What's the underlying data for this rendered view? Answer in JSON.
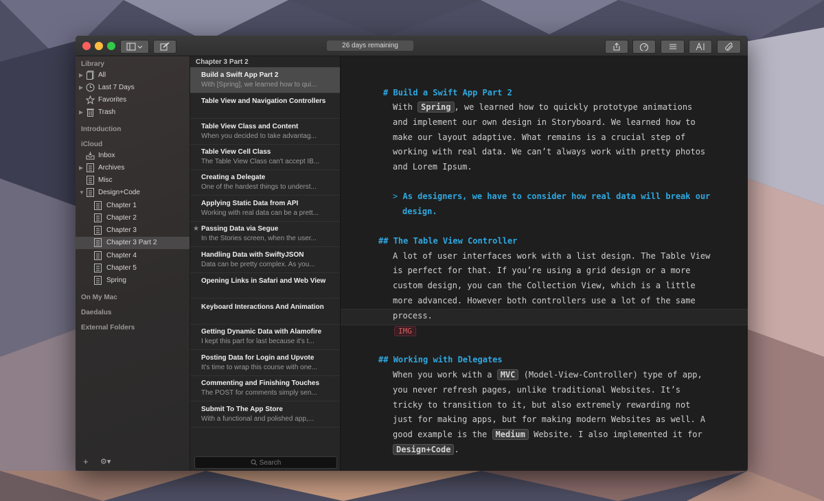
{
  "toolbar": {
    "trial_label": "26 days remaining"
  },
  "sidebar": {
    "library_header": "Library",
    "library_items": [
      "All",
      "Last 7 Days",
      "Favorites",
      "Trash"
    ],
    "introduction": "Introduction",
    "icloud_header": "iCloud",
    "icloud_items": [
      "Inbox",
      "Archives",
      "Misc",
      "Design+Code"
    ],
    "chapters": [
      "Chapter 1",
      "Chapter 2",
      "Chapter 3",
      "Chapter 3 Part 2",
      "Chapter 4",
      "Chapter 5",
      "Spring"
    ],
    "selected": "Chapter 3 Part 2",
    "on_my_mac": "On My Mac",
    "daedalus": "Daedalus",
    "external": "External Folders",
    "add_label": "+",
    "gear_label": "⚙▾"
  },
  "list": {
    "header": "Chapter 3 Part 2",
    "search_placeholder": "Search",
    "rows": [
      {
        "title": "Build a Swift App Part 2",
        "preview": "With [Spring], we learned how to qui..."
      },
      {
        "title": "Table View and Navigation Controllers",
        "preview": ""
      },
      {
        "title": "Table View Class and Content",
        "preview": "When you decided to take advantag..."
      },
      {
        "title": "Table View Cell Class",
        "preview": "The Table View Class can't accept IB..."
      },
      {
        "title": "Creating a Delegate",
        "preview": "One of the hardest things to underst..."
      },
      {
        "title": "Applying Static Data from API",
        "preview": "Working with real data can be a prett..."
      },
      {
        "title": "Passing Data via Segue",
        "preview": "In the Stories screen, when the user..."
      },
      {
        "title": "Handling Data with SwiftyJSON",
        "preview": "Data can be pretty complex. As you..."
      },
      {
        "title": "Opening Links in Safari and Web View",
        "preview": ""
      },
      {
        "title": "Keyboard Interactions And Animation",
        "preview": ""
      },
      {
        "title": "Getting Dynamic Data with Alamofire",
        "preview": "I kept this part for last because it's t..."
      },
      {
        "title": "Posting Data for Login and Upvote",
        "preview": "It's time to wrap this course with one..."
      },
      {
        "title": "Commenting and Finishing Touches",
        "preview": "The POST for comments simply sen..."
      },
      {
        "title": "Submit To The App Store",
        "preview": "With a functional and polished app,..."
      }
    ]
  },
  "editor": {
    "h1_mark": "#",
    "h1": "Build a Swift App Part 2",
    "p1_l1_a": "With",
    "p1_code": "Spring",
    "p1_l1_b": ", we learned how to quickly prototype animations",
    "p1_l2": "and implement our own design in Storyboard. We learned how to",
    "p1_l3": "make our layout adaptive. What remains is a crucial step of",
    "p1_l4": "working with real data. We can’t always work with pretty photos",
    "p1_l5": "and Lorem Ipsum.",
    "quote_mark": ">",
    "quote_l1": "As designers, we have to consider how real data will break our",
    "quote_l2": "design.",
    "h2a_mark": "##",
    "h2a": "The Table View Controller",
    "p2_l1": "A lot of user interfaces work with a list design. The Table View",
    "p2_l2": "is perfect for that. If you’re using a grid design or a more",
    "p2_l3": "custom design, you can the Collection View, which is a little",
    "p2_l4": "more advanced. However both controllers use a lot of the same",
    "p2_l5": "process.",
    "img_tag": "IMG",
    "h2b_mark": "##",
    "h2b": "Working with Delegates",
    "p3_l1_a": "When you work with a",
    "p3_code1": "MVC",
    "p3_l1_b": "(Model-View-Controller) type of app,",
    "p3_l2": "you never refresh pages, unlike traditional Websites. It’s",
    "p3_l3": "tricky to transition to it, but also extremely rewarding not",
    "p3_l4": "just for making apps, but for making modern Websites as well. A",
    "p3_l5_a": "good example is the",
    "p3_code2": "Medium",
    "p3_l5_b": "Website. I also implemented it for",
    "p3_code3": "Design+Code",
    "p3_l6_b": "."
  },
  "colors": {
    "heading": "#2fa8e0",
    "close": "#fc615d",
    "minimize": "#fdbc40",
    "zoom": "#34c84a"
  }
}
